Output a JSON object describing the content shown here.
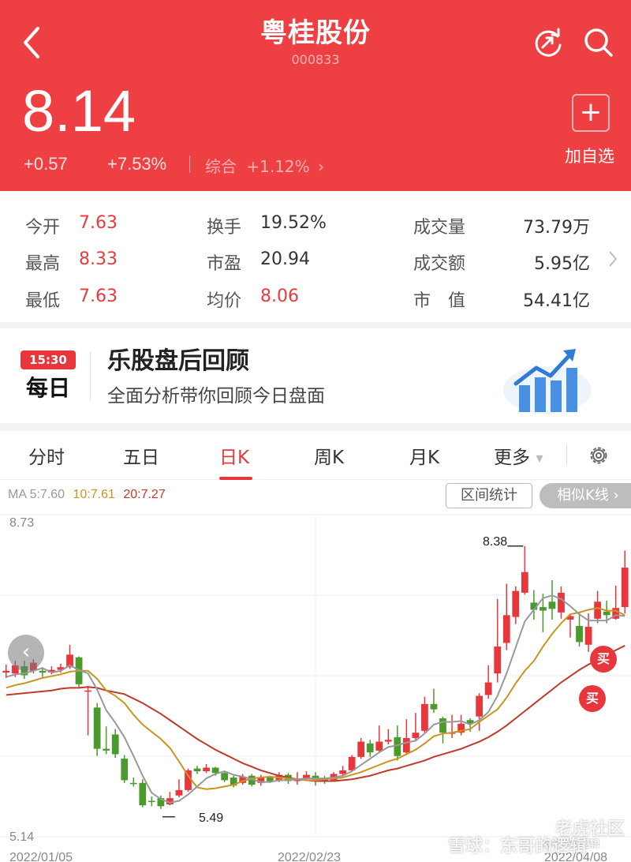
{
  "header": {
    "title": "粤桂股份",
    "code": "000833",
    "price": "8.14",
    "change": "+0.57",
    "change_pct": "+7.53%",
    "composite_label": "综合",
    "composite_value": "+1.12%",
    "add_fav_icon": "+",
    "add_fav_label": "加自选",
    "colors": {
      "bg": "#ee3f43"
    }
  },
  "stats": {
    "open": {
      "label": "今开",
      "value": "7.63"
    },
    "high": {
      "label": "最高",
      "value": "8.33"
    },
    "low": {
      "label": "最低",
      "value": "7.63"
    },
    "turnover": {
      "label": "换手",
      "value": "19.52%"
    },
    "pe": {
      "label": "市盈",
      "value": "20.94"
    },
    "avg": {
      "label": "均价",
      "value": "8.06"
    },
    "volume": {
      "label": "成交量",
      "value": "73.79万"
    },
    "amount": {
      "label": "成交额",
      "value": "5.95亿"
    },
    "mktcap": {
      "label": "市　值",
      "value": "54.41亿"
    }
  },
  "banner": {
    "badge_time": "15:30",
    "badge_day": "每日",
    "title": "乐股盘后回顾",
    "subtitle": "全面分析带你回顾今日盘面"
  },
  "tabs": [
    {
      "label": "分时"
    },
    {
      "label": "五日"
    },
    {
      "label": "日K"
    },
    {
      "label": "周K"
    },
    {
      "label": "月K"
    },
    {
      "label": "更多"
    }
  ],
  "chart_panel": {
    "ma5": "MA 5:7.60",
    "ma10": "10:7.61",
    "ma20": "20:7.27",
    "range_button": "区间统计",
    "similar_button": "相似K线 ›",
    "ymax_label": "8.73",
    "ymin_label": "5.14",
    "high_marker": "8.38",
    "low_marker": "5.49",
    "buy_label": "买",
    "dates": [
      "2022/01/05",
      "2022/02/23",
      "2022/04/08"
    ],
    "watermark_1": "老虎社区",
    "watermark_2": "雪球：东哥的逻辑",
    "watermark_small": "@东哥的逻辑",
    "colors": {
      "up": "#e8373c",
      "down": "#4a9a2e",
      "ma5": "#999999",
      "ma10": "#c8961e",
      "ma20": "#c0392b"
    }
  },
  "chart_data": {
    "type": "candlestick",
    "ylim": [
      5.14,
      8.73
    ],
    "candles": [
      [
        6.97,
        6.99,
        7.06,
        6.91
      ],
      [
        6.96,
        7.05,
        7.1,
        6.92
      ],
      [
        7.04,
        6.94,
        7.1,
        6.9
      ],
      [
        6.99,
        7.08,
        7.12,
        6.96
      ],
      [
        6.99,
        6.97,
        7.03,
        6.92
      ],
      [
        6.97,
        7.0,
        7.04,
        6.95
      ],
      [
        7.0,
        7.03,
        7.07,
        6.97
      ],
      [
        7.03,
        7.17,
        7.28,
        7.01
      ],
      [
        7.14,
        6.84,
        7.15,
        6.81
      ],
      [
        6.77,
        6.77,
        6.82,
        6.27
      ],
      [
        6.58,
        6.12,
        6.63,
        6.04
      ],
      [
        6.12,
        6.1,
        6.37,
        6.06
      ],
      [
        6.28,
        6.06,
        6.34,
        6.02
      ],
      [
        6.01,
        5.77,
        6.05,
        5.74
      ],
      [
        5.74,
        5.73,
        5.8,
        5.7
      ],
      [
        5.74,
        5.49,
        5.78,
        5.47
      ],
      [
        5.54,
        5.53,
        5.59,
        5.48
      ],
      [
        5.57,
        5.48,
        5.6,
        5.45
      ],
      [
        5.5,
        5.57,
        5.64,
        5.49
      ],
      [
        5.6,
        5.66,
        5.78,
        5.58
      ],
      [
        5.66,
        5.88,
        5.9,
        5.64
      ],
      [
        5.9,
        5.87,
        5.93,
        5.84
      ],
      [
        5.87,
        5.91,
        5.95,
        5.85
      ],
      [
        5.91,
        5.85,
        5.92,
        5.82
      ],
      [
        5.85,
        5.77,
        5.87,
        5.75
      ],
      [
        5.8,
        5.71,
        5.82,
        5.69
      ],
      [
        5.74,
        5.81,
        5.84,
        5.72
      ],
      [
        5.82,
        5.72,
        5.84,
        5.7
      ],
      [
        5.74,
        5.8,
        5.83,
        5.71
      ],
      [
        5.8,
        5.76,
        5.82,
        5.74
      ],
      [
        5.76,
        5.83,
        5.86,
        5.75
      ],
      [
        5.83,
        5.76,
        5.85,
        5.73
      ],
      [
        5.76,
        5.79,
        5.86,
        5.72
      ],
      [
        5.79,
        5.83,
        5.87,
        5.77
      ],
      [
        5.82,
        5.78,
        5.86,
        5.71
      ],
      [
        5.78,
        5.77,
        5.82,
        5.73
      ],
      [
        5.77,
        5.84,
        5.86,
        5.76
      ],
      [
        5.84,
        5.88,
        5.93,
        5.82
      ],
      [
        5.88,
        6.03,
        6.05,
        5.86
      ],
      [
        6.03,
        6.2,
        6.24,
        6.01
      ],
      [
        6.18,
        6.08,
        6.22,
        6.03
      ],
      [
        6.1,
        6.2,
        6.38,
        6.08
      ],
      [
        6.2,
        6.22,
        6.34,
        6.17
      ],
      [
        6.25,
        6.04,
        6.38,
        5.99
      ],
      [
        6.08,
        6.24,
        6.45,
        6.05
      ],
      [
        6.24,
        6.3,
        6.52,
        6.22
      ],
      [
        6.32,
        6.62,
        6.7,
        6.29
      ],
      [
        6.62,
        6.56,
        6.79,
        6.52
      ],
      [
        6.46,
        6.3,
        6.48,
        6.18
      ],
      [
        6.3,
        6.3,
        6.5,
        6.24
      ],
      [
        6.3,
        6.4,
        6.5,
        6.27
      ],
      [
        6.44,
        6.4,
        6.46,
        6.31
      ],
      [
        6.48,
        6.71,
        6.74,
        6.32
      ],
      [
        6.72,
        6.86,
        7.05,
        6.68
      ],
      [
        6.96,
        7.26,
        7.79,
        6.86
      ],
      [
        7.3,
        7.61,
        7.96,
        7.22
      ],
      [
        7.59,
        7.88,
        7.93,
        7.51
      ],
      [
        7.86,
        8.09,
        8.38,
        7.84
      ],
      [
        7.75,
        7.67,
        7.89,
        7.56
      ],
      [
        7.7,
        7.66,
        7.85,
        7.42
      ],
      [
        7.76,
        7.68,
        8.0,
        7.56
      ],
      [
        7.64,
        7.86,
        7.93,
        7.57
      ],
      [
        7.56,
        7.6,
        7.62,
        7.36
      ],
      [
        7.49,
        7.31,
        7.65,
        7.26
      ],
      [
        7.28,
        7.48,
        7.63,
        7.2
      ],
      [
        7.57,
        7.76,
        7.88,
        7.52
      ],
      [
        7.65,
        7.61,
        7.77,
        7.52
      ],
      [
        7.57,
        7.69,
        7.94,
        7.56
      ],
      [
        7.7,
        8.14,
        8.33,
        7.63
      ]
    ],
    "ma5": [
      6.92,
      6.95,
      6.96,
      6.99,
      7.02,
      6.97,
      6.99,
      7.05,
      7.0,
      6.96,
      6.78,
      6.55,
      6.41,
      6.25,
      6.04,
      5.82,
      5.63,
      5.56,
      5.52,
      5.54,
      5.61,
      5.7,
      5.79,
      5.84,
      5.87,
      5.83,
      5.81,
      5.78,
      5.75,
      5.75,
      5.77,
      5.77,
      5.78,
      5.79,
      5.79,
      5.79,
      5.8,
      5.82,
      5.87,
      5.94,
      6.01,
      6.08,
      6.14,
      6.16,
      6.19,
      6.21,
      6.29,
      6.39,
      6.42,
      6.42,
      6.43,
      6.39,
      6.44,
      6.53,
      6.71,
      6.96,
      7.25,
      7.54,
      7.67,
      7.8,
      7.83,
      7.79,
      7.71,
      7.62,
      7.55,
      7.55,
      7.55,
      7.61,
      7.6
    ],
    "ma10": [
      6.8,
      6.83,
      6.85,
      6.88,
      6.91,
      6.93,
      6.95,
      6.98,
      6.99,
      6.99,
      6.9,
      6.77,
      6.71,
      6.63,
      6.5,
      6.39,
      6.31,
      6.23,
      6.13,
      5.98,
      5.82,
      5.69,
      5.67,
      5.68,
      5.7,
      5.72,
      5.76,
      5.79,
      5.8,
      5.81,
      5.8,
      5.79,
      5.78,
      5.77,
      5.77,
      5.78,
      5.79,
      5.8,
      5.83,
      5.86,
      5.9,
      5.94,
      5.98,
      6.01,
      6.06,
      6.11,
      6.18,
      6.26,
      6.29,
      6.3,
      6.32,
      6.34,
      6.42,
      6.49,
      6.56,
      6.69,
      6.85,
      6.99,
      7.1,
      7.26,
      7.4,
      7.52,
      7.62,
      7.64,
      7.67,
      7.69,
      7.66,
      7.66,
      7.61
    ],
    "ma20": [
      6.72,
      6.73,
      6.74,
      6.75,
      6.76,
      6.77,
      6.79,
      6.8,
      6.8,
      6.81,
      6.8,
      6.77,
      6.75,
      6.73,
      6.68,
      6.63,
      6.57,
      6.51,
      6.44,
      6.37,
      6.3,
      6.23,
      6.17,
      6.11,
      6.06,
      6.01,
      5.96,
      5.92,
      5.88,
      5.85,
      5.82,
      5.8,
      5.78,
      5.77,
      5.76,
      5.76,
      5.76,
      5.77,
      5.78,
      5.8,
      5.82,
      5.85,
      5.88,
      5.9,
      5.93,
      5.96,
      5.99,
      6.03,
      6.06,
      6.09,
      6.12,
      6.16,
      6.2,
      6.25,
      6.31,
      6.38,
      6.46,
      6.54,
      6.62,
      6.7,
      6.78,
      6.86,
      6.93,
      7.0,
      7.06,
      7.11,
      7.16,
      7.22,
      7.27
    ]
  }
}
